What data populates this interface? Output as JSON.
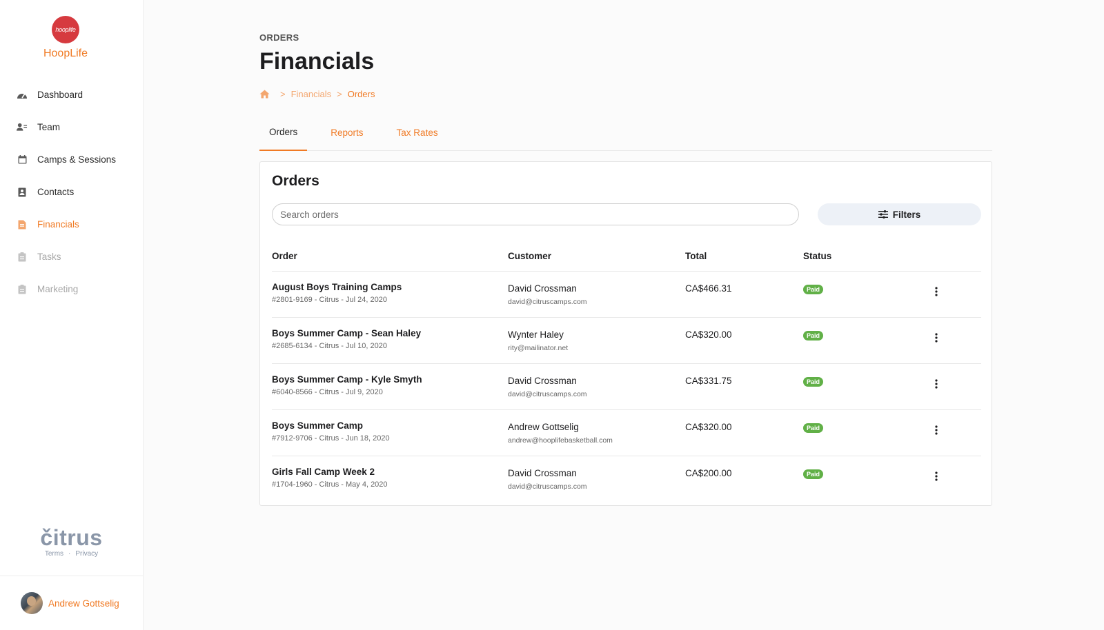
{
  "brand": {
    "logo_text": "hooplife",
    "name": "HoopLife",
    "accent": "#f07a24",
    "logo_color": "#d63a3f"
  },
  "nav": {
    "items": [
      {
        "label": "Dashboard",
        "icon": "dashboard-icon",
        "state": "normal"
      },
      {
        "label": "Team",
        "icon": "team-icon",
        "state": "normal"
      },
      {
        "label": "Camps & Sessions",
        "icon": "calendar-icon",
        "state": "normal"
      },
      {
        "label": "Contacts",
        "icon": "contacts-icon",
        "state": "normal"
      },
      {
        "label": "Financials",
        "icon": "financials-icon",
        "state": "active"
      },
      {
        "label": "Tasks",
        "icon": "tasks-icon",
        "state": "disabled"
      },
      {
        "label": "Marketing",
        "icon": "marketing-icon",
        "state": "disabled"
      }
    ]
  },
  "footer": {
    "logo_text": "čitrus",
    "terms": "Terms",
    "dot": "·",
    "privacy": "Privacy"
  },
  "user": {
    "name": "Andrew Gottselig"
  },
  "header": {
    "eyebrow": "ORDERS",
    "title": "Financials"
  },
  "breadcrumb": {
    "sep": ">",
    "level1": "Financials",
    "current": "Orders"
  },
  "tabs": [
    {
      "label": "Orders",
      "active": true
    },
    {
      "label": "Reports",
      "active": false
    },
    {
      "label": "Tax Rates",
      "active": false
    }
  ],
  "card": {
    "title": "Orders",
    "search_placeholder": "Search orders",
    "filters_label": "Filters"
  },
  "table": {
    "columns": [
      "Order",
      "Customer",
      "Total",
      "Status"
    ],
    "rows": [
      {
        "name": "August Boys Training Camps",
        "meta": "#2801-9169 - Citrus - Jul 24, 2020",
        "customer": "David Crossman",
        "email": "david@citruscamps.com",
        "total": "CA$466.31",
        "status": "Paid"
      },
      {
        "name": "Boys Summer Camp - Sean Haley",
        "meta": "#2685-6134 - Citrus - Jul 10, 2020",
        "customer": "Wynter Haley",
        "email": "rity@mailinator.net",
        "total": "CA$320.00",
        "status": "Paid"
      },
      {
        "name": "Boys Summer Camp - Kyle Smyth",
        "meta": "#6040-8566 - Citrus - Jul 9, 2020",
        "customer": "David Crossman",
        "email": "david@citruscamps.com",
        "total": "CA$331.75",
        "status": "Paid"
      },
      {
        "name": "Boys Summer Camp",
        "meta": "#7912-9706 - Citrus - Jun 18, 2020",
        "customer": "Andrew Gottselig",
        "email": "andrew@hooplifebasketball.com",
        "total": "CA$320.00",
        "status": "Paid"
      },
      {
        "name": "Girls Fall Camp Week 2",
        "meta": "#1704-1960 - Citrus - May 4, 2020",
        "customer": "David Crossman",
        "email": "david@citruscamps.com",
        "total": "CA$200.00",
        "status": "Paid"
      }
    ],
    "paid_color": "#61b047"
  }
}
